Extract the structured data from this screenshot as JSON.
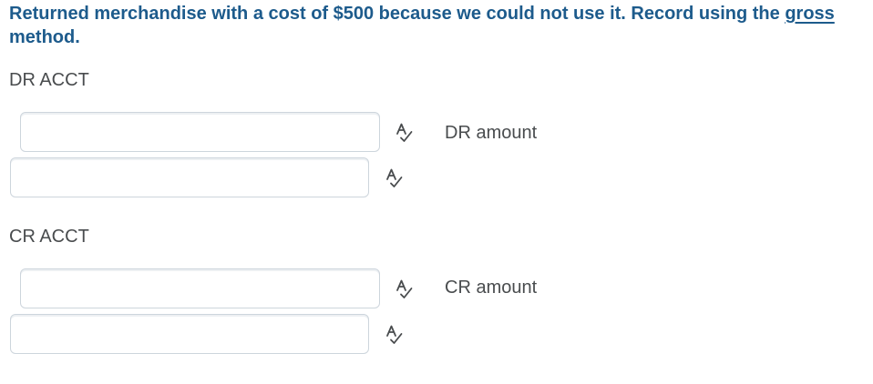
{
  "question": {
    "text_before": "Returned merchandise with a cost of $500 because we could not use it.  Record using the ",
    "link_word": "gross",
    "text_after": " method."
  },
  "dr_section": {
    "label": "DR ACCT",
    "account_value": "",
    "second_value": "",
    "amount_label": "DR amount"
  },
  "cr_section": {
    "label": "CR ACCT",
    "account_value": "",
    "second_value": "",
    "amount_label": "CR amount"
  },
  "icons": {
    "spellcheck": "spellcheck-icon"
  }
}
